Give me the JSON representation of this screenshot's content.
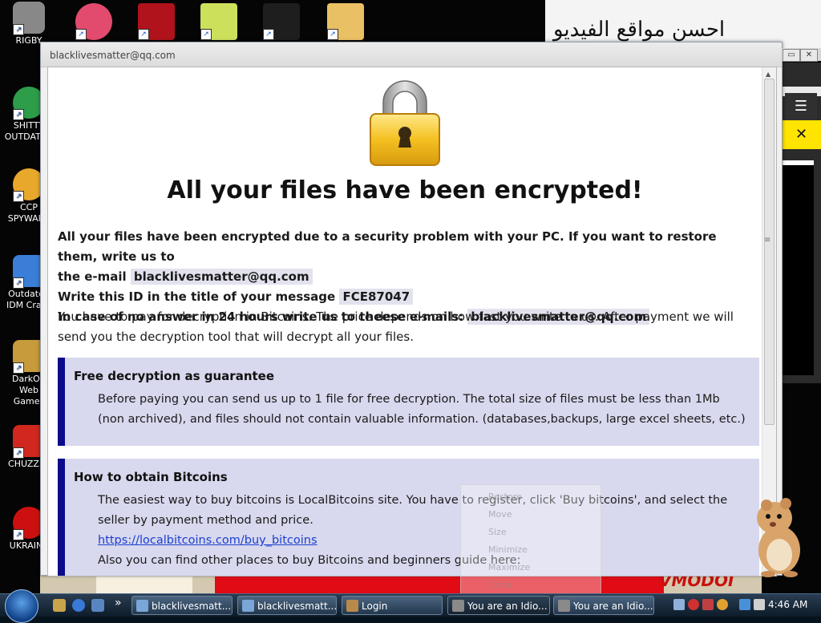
{
  "desktop": {
    "background_text": "احسن مواقع الفيديو",
    "vm_text": "VMODOI",
    "right_panel_menu_glyph": "☰",
    "right_panel_close_glyph": "✕",
    "left_icons": [
      {
        "name": "rigby-icon",
        "label": "RIGBY",
        "color": "#888888"
      },
      {
        "name": "chrome-icon",
        "label": "SHITTY OUTDATED",
        "color": "#2d9d4a"
      },
      {
        "name": "ccleaner-icon",
        "label": "CCP SPYWARE",
        "color": "#e8a82c"
      },
      {
        "name": "idm-icon",
        "label": "Outdated IDM Crack",
        "color": "#3a7ed8"
      },
      {
        "name": "money-bag-icon",
        "label": "DarkOK Web Games",
        "color": "#c79a3c"
      },
      {
        "name": "chuzzle-icon",
        "label": "CHUZZLE",
        "color": "#d0281e"
      },
      {
        "name": "radiation-icon",
        "label": "UKRAINE",
        "color": "#cc1010"
      }
    ],
    "top_icons": [
      {
        "name": "pinball-p-icon",
        "color": "#e24a6e"
      },
      {
        "name": "flash-icon",
        "color": "#b0131b"
      },
      {
        "name": "hxd-icon",
        "color": "#cde05c"
      },
      {
        "name": "cmd-icon",
        "color": "#1e1e1e"
      },
      {
        "name": "folder-icon",
        "color": "#e9c064"
      }
    ]
  },
  "window": {
    "title": "blacklivesmatter@qq.com",
    "restore_glyph": "▭",
    "close_glyph": "✕"
  },
  "note": {
    "headline": "All your files have been encrypted!",
    "line1_a": "All your files have been encrypted due to a security problem with your PC. If you want to restore them, write us to",
    "line1_b": "the e-mail",
    "email": "blacklivesmatter@qq.com",
    "id_label": "Write this ID in the title of your message",
    "id_value": "FCE87047",
    "noanswer_label": "In case of no answer in 24 hours write us to theese e-mails:",
    "noanswer_email": "blacklivesmatter@qq.com",
    "pay_text": "You have to pay for decryption in Bitcoins. The price depends on how fast you write to us. After payment we will send you the decryption tool that will decrypt all your files.",
    "free_box": {
      "heading": "Free decryption as guarantee",
      "text": "Before paying you can send us up to 1 file for free decryption. The total size of files must be less than 1Mb (non archived), and files should not contain valuable information. (databases,backups, large excel sheets, etc.)"
    },
    "btc_box": {
      "heading": "How to obtain Bitcoins",
      "text": "The easiest way to buy bitcoins is LocalBitcoins site. You have to register, click 'Buy bitcoins', and select the seller by payment method and price.",
      "link": "https://localbitcoins.com/buy_bitcoins",
      "more": "Also you can find other places to buy Bitcoins and beginners guide here:"
    }
  },
  "ghost_menu": [
    "Restore",
    "Move",
    "Size",
    "Minimize",
    "Maximize",
    "Close"
  ],
  "taskbar": {
    "buttons": [
      {
        "label": "blacklivesmatt...",
        "icon_color": "#7aa6d8"
      },
      {
        "label": "blacklivesmatt...",
        "icon_color": "#7aa6d8"
      },
      {
        "label": "Login",
        "icon_color": "#b88a4a"
      },
      {
        "label": "You are an Idio...",
        "icon_color": "#8a8a8a"
      },
      {
        "label": "You are an Idio...",
        "icon_color": "#8a8a8a"
      }
    ],
    "overflow_glyph": "»",
    "clock": "4:46 AM"
  }
}
